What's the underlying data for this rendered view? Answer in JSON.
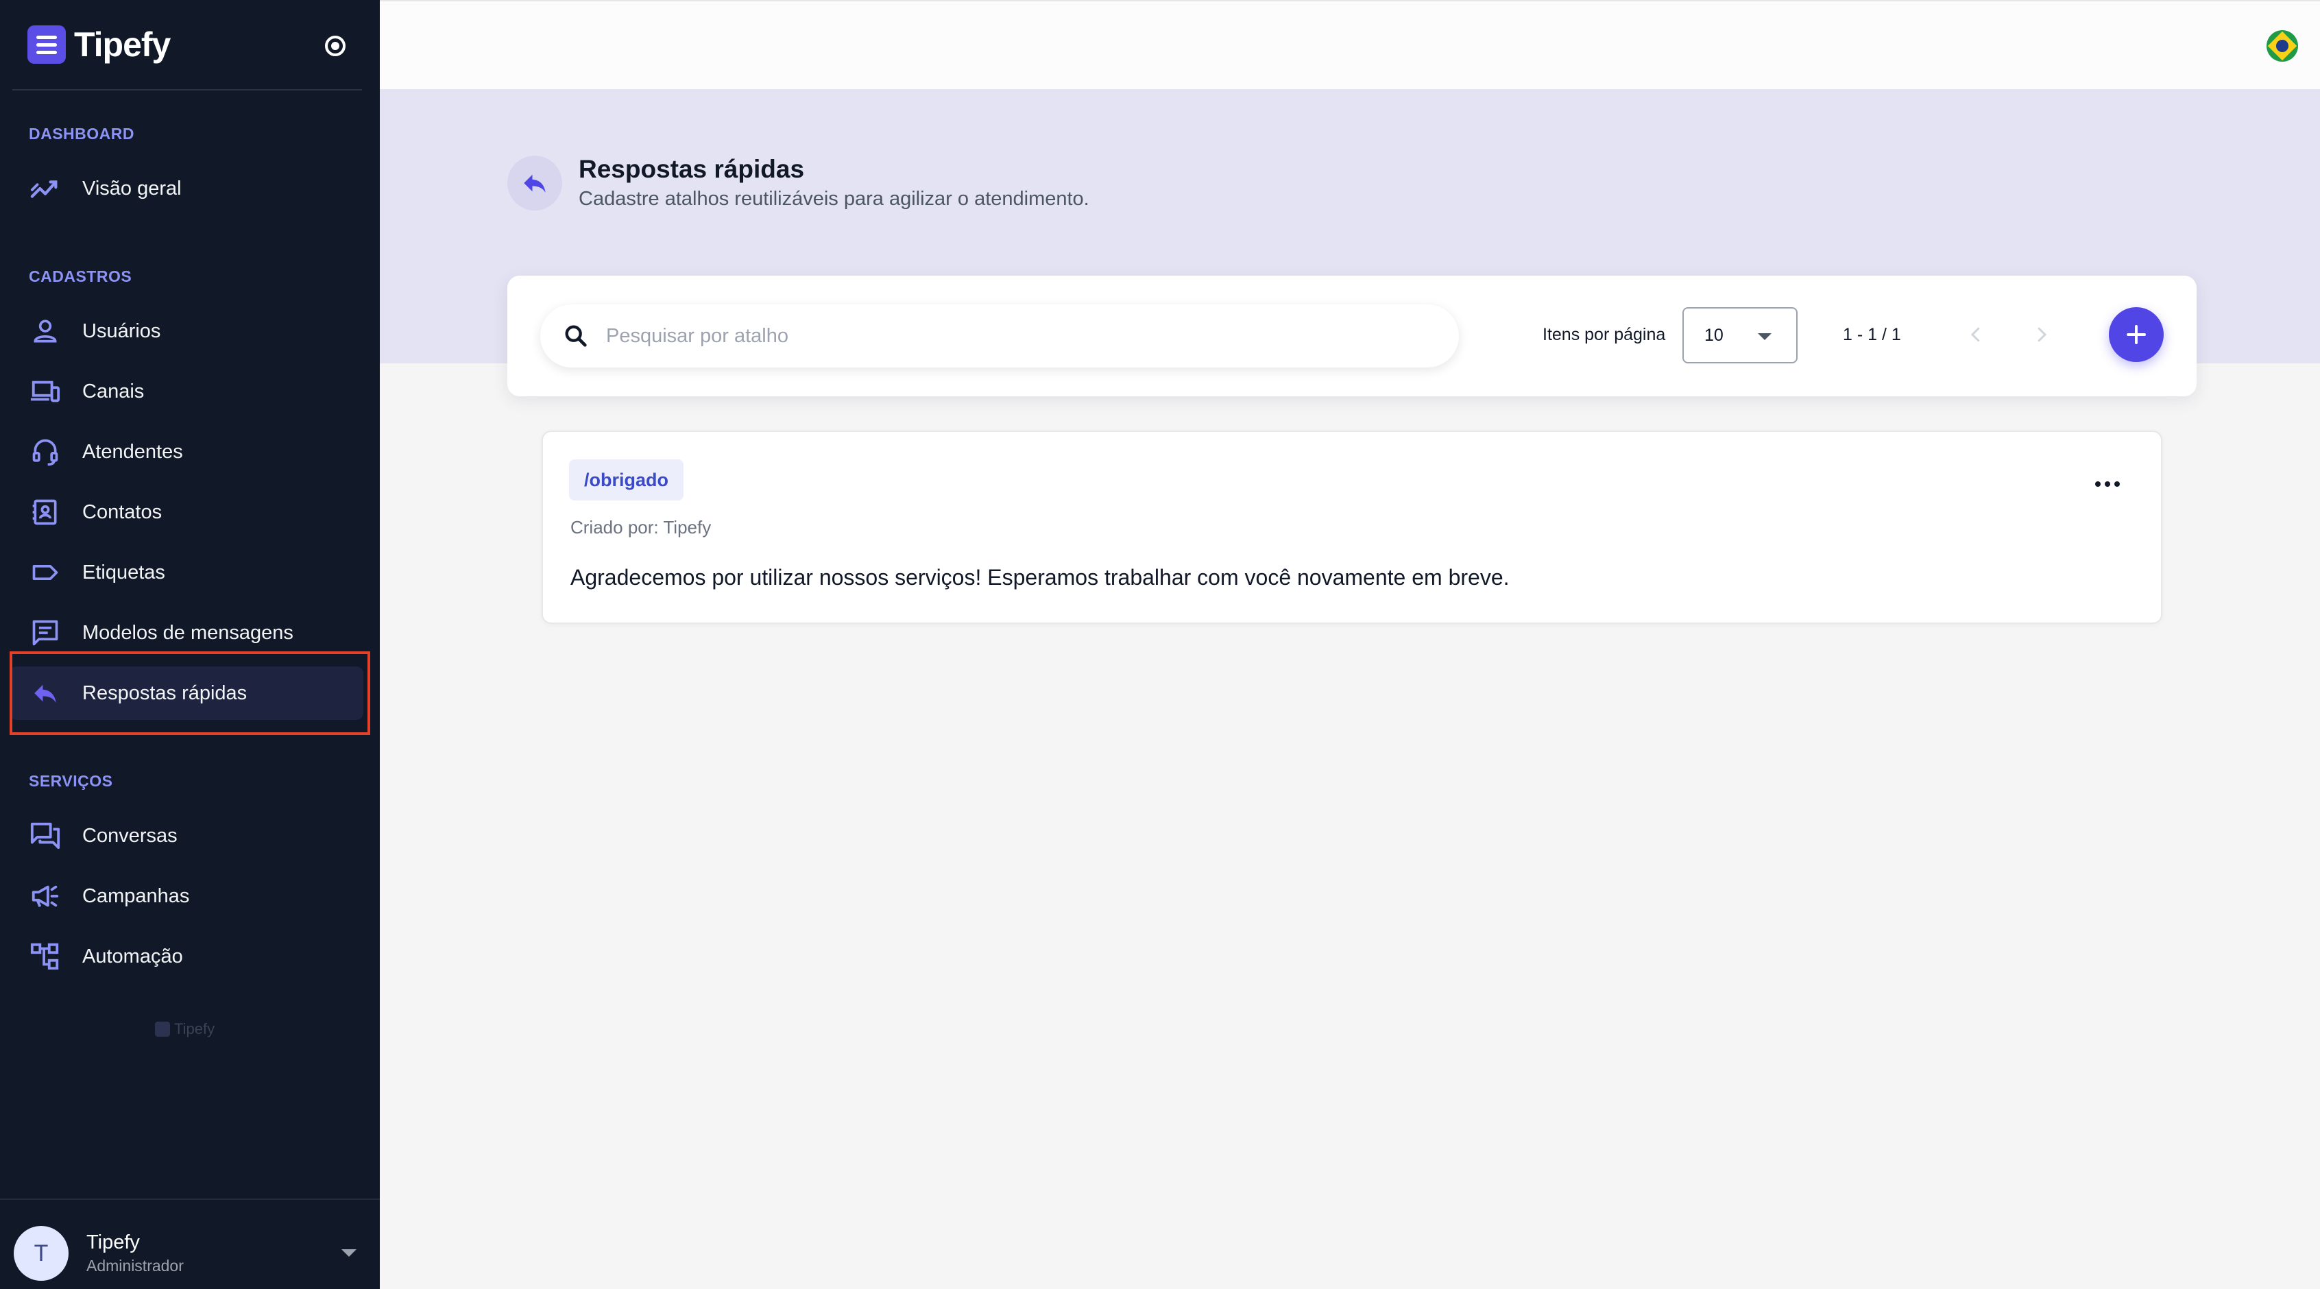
{
  "app": {
    "name": "Tipefy"
  },
  "sidebar": {
    "sections": {
      "dashboard": "DASHBOARD",
      "cadastros": "CADASTROS",
      "servicos": "SERVIÇOS"
    },
    "items": {
      "visao_geral": {
        "label": "Visão geral",
        "icon": "trending-up-icon"
      },
      "usuarios": {
        "label": "Usuários",
        "icon": "person-icon"
      },
      "canais": {
        "label": "Canais",
        "icon": "devices-icon"
      },
      "atendentes": {
        "label": "Atendentes",
        "icon": "headset-icon"
      },
      "contatos": {
        "label": "Contatos",
        "icon": "contact-card-icon"
      },
      "etiquetas": {
        "label": "Etiquetas",
        "icon": "label-tag-icon"
      },
      "modelos": {
        "label": "Modelos de mensagens",
        "icon": "message-template-icon"
      },
      "respostas": {
        "label": "Respostas rápidas",
        "icon": "reply-icon",
        "active": true
      },
      "conversas": {
        "label": "Conversas",
        "icon": "chat-bubbles-icon"
      },
      "campanhas": {
        "label": "Campanhas",
        "icon": "megaphone-icon"
      },
      "automacao": {
        "label": "Automação",
        "icon": "flow-icon"
      }
    },
    "watermark": "Tipefy",
    "user": {
      "initial": "T",
      "name": "Tipefy",
      "role": "Administrador"
    }
  },
  "page": {
    "title": "Respostas rápidas",
    "subtitle": "Cadastre atalhos reutilizáveis para agilizar o atendimento."
  },
  "toolbar": {
    "search_placeholder": "Pesquisar por atalho",
    "search_value": "",
    "per_page_label": "Itens por página",
    "per_page_value": "10",
    "range": "1 - 1 / 1"
  },
  "replies": [
    {
      "shortcut": "/obrigado",
      "created_by": "Criado por: Tipefy",
      "message": "Agradecemos por utilizar nossos serviços! Esperamos trabalhar com você novamente em breve."
    }
  ],
  "colors": {
    "sidebar_bg": "#111827",
    "accent": "#5146e5",
    "section_label": "#8c93f5",
    "hero_bg": "#e4e3f3",
    "highlight_outline": "#e4412b"
  }
}
